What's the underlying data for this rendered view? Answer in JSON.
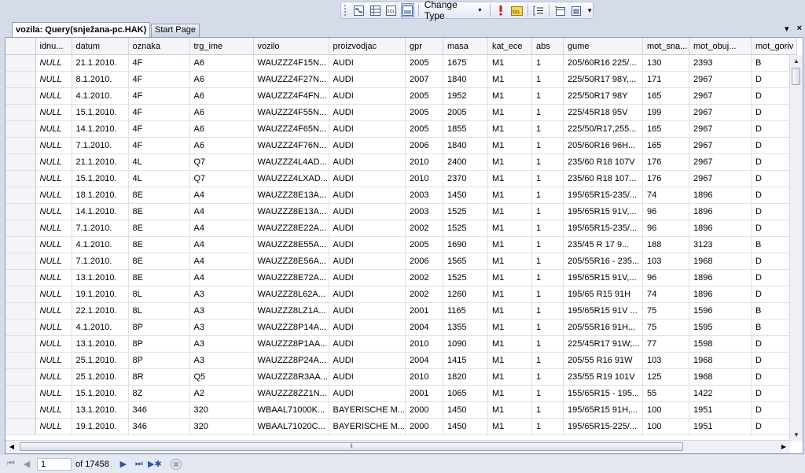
{
  "toolbar": {
    "change_type_label": "Change Type",
    "buttons": [
      "show-diagram-pane-icon",
      "show-grid-pane-icon",
      "show-sql-pane-icon",
      "show-results-pane-icon",
      "execute-sql-icon",
      "verify-sql-icon",
      "group-by-icon",
      "add-table-icon",
      "add-derived-table-icon"
    ]
  },
  "tabs": {
    "active_label": "vozila: Query(snježana-pc.HAK)",
    "second_label": "Start Page",
    "pin_glyph": "▾",
    "close_glyph": "×"
  },
  "grid": {
    "columns": [
      "idnu...",
      "datum",
      "oznaka",
      "trg_ime",
      "vozilo",
      "proizvodjac",
      "gpr",
      "masa",
      "kat_ece",
      "abs",
      "gume",
      "mot_sna...",
      "mot_obuj...",
      "mot_goriv"
    ],
    "rows": [
      [
        "NULL",
        "21.1.2010.",
        "4F",
        "A6",
        "WAUZZZ4F15N...",
        "AUDI",
        "2005",
        "1675",
        "M1",
        "1",
        "205/60R16 225/...",
        "130",
        "2393",
        "B"
      ],
      [
        "NULL",
        "8.1.2010.",
        "4F",
        "A6",
        "WAUZZZ4F27N...",
        "AUDI",
        "2007",
        "1840",
        "M1",
        "1",
        "225/50R17 98Y,...",
        "171",
        "2967",
        "D"
      ],
      [
        "NULL",
        "4.1.2010.",
        "4F",
        "A6",
        "WAUZZZ4F4FN...",
        "AUDI",
        "2005",
        "1952",
        "M1",
        "1",
        "225/50R17 98Y",
        "165",
        "2967",
        "D"
      ],
      [
        "NULL",
        "15.1.2010.",
        "4F",
        "A6",
        "WAUZZZ4F55N...",
        "AUDI",
        "2005",
        "2005",
        "M1",
        "1",
        "225/45R18 95V",
        "199",
        "2967",
        "D"
      ],
      [
        "NULL",
        "14.1.2010.",
        "4F",
        "A6",
        "WAUZZZ4F65N...",
        "AUDI",
        "2005",
        "1855",
        "M1",
        "1",
        "225/50/R17,255...",
        "165",
        "2967",
        "D"
      ],
      [
        "NULL",
        "7.1.2010.",
        "4F",
        "A6",
        "WAUZZZ4F76N...",
        "AUDI",
        "2006",
        "1840",
        "M1",
        "1",
        "205/60R16 96H...",
        "165",
        "2967",
        "D"
      ],
      [
        "NULL",
        "21.1.2010.",
        "4L",
        "Q7",
        "WAUZZZ4L4AD...",
        "AUDI",
        "2010",
        "2400",
        "M1",
        "1",
        "235/60 R18 107V",
        "176",
        "2967",
        "D"
      ],
      [
        "NULL",
        "15.1.2010.",
        "4L",
        "Q7",
        "WAUZZZ4LXAD...",
        "AUDI",
        "2010",
        "2370",
        "M1",
        "1",
        "235/60 R18 107...",
        "176",
        "2967",
        "D"
      ],
      [
        "NULL",
        "18.1.2010.",
        "8E",
        "A4",
        "WAUZZZ8E13A...",
        "AUDI",
        "2003",
        "1450",
        "M1",
        "1",
        "195/65R15-235/...",
        "74",
        "1896",
        "D"
      ],
      [
        "NULL",
        "14.1.2010.",
        "8E",
        "A4",
        "WAUZZZ8E13A...",
        "AUDI",
        "2003",
        "1525",
        "M1",
        "1",
        "195/65R15 91V,...",
        "96",
        "1896",
        "D"
      ],
      [
        "NULL",
        "7.1.2010.",
        "8E",
        "A4",
        "WAUZZZ8E22A...",
        "AUDI",
        "2002",
        "1525",
        "M1",
        "1",
        "195/65R15-235/...",
        "96",
        "1896",
        "D"
      ],
      [
        "NULL",
        "4.1.2010.",
        "8E",
        "A4",
        "WAUZZZ8E55A...",
        "AUDI",
        "2005",
        "1690",
        "M1",
        "1",
        "235/45 R 17 9...",
        "188",
        "3123",
        "B"
      ],
      [
        "NULL",
        "7.1.2010.",
        "8E",
        "A4",
        "WAUZZZ8E56A...",
        "AUDI",
        "2006",
        "1565",
        "M1",
        "1",
        "205/55R16 - 235...",
        "103",
        "1968",
        "D"
      ],
      [
        "NULL",
        "13.1.2010.",
        "8E",
        "A4",
        "WAUZZZ8E72A...",
        "AUDI",
        "2002",
        "1525",
        "M1",
        "1",
        "195/65R15 91V,...",
        "96",
        "1896",
        "D"
      ],
      [
        "NULL",
        "19.1.2010.",
        "8L",
        "A3",
        "WAUZZZ8L62A...",
        "AUDI",
        "2002",
        "1260",
        "M1",
        "1",
        "195/65 R15 91H",
        "74",
        "1896",
        "D"
      ],
      [
        "NULL",
        "22.1.2010.",
        "8L",
        "A3",
        "WAUZZZ8LZ1A...",
        "AUDI",
        "2001",
        "1165",
        "M1",
        "1",
        "195/65R15 91V ...",
        "75",
        "1596",
        "B"
      ],
      [
        "NULL",
        "4.1.2010.",
        "8P",
        "A3",
        "WAUZZZ8P14A...",
        "AUDI",
        "2004",
        "1355",
        "M1",
        "1",
        "205/55R16 91H...",
        "75",
        "1595",
        "B"
      ],
      [
        "NULL",
        "13.1.2010.",
        "8P",
        "A3",
        "WAUZZZ8P1AA...",
        "AUDI",
        "2010",
        "1090",
        "M1",
        "1",
        "225/45R17 91W;...",
        "77",
        "1598",
        "D"
      ],
      [
        "NULL",
        "25.1.2010.",
        "8P",
        "A3",
        "WAUZZZ8P24A...",
        "AUDI",
        "2004",
        "1415",
        "M1",
        "1",
        "205/55 R16 91W",
        "103",
        "1968",
        "D"
      ],
      [
        "NULL",
        "25.1.2010.",
        "8R",
        "Q5",
        "WAUZZZ8R3AA...",
        "AUDI",
        "2010",
        "1820",
        "M1",
        "1",
        "235/55 R19 101V",
        "125",
        "1968",
        "D"
      ],
      [
        "NULL",
        "15.1.2010.",
        "8Z",
        "A2",
        "WAUZZZ8ZZ1N...",
        "AUDI",
        "2001",
        "1065",
        "M1",
        "1",
        "155/65R15 - 195...",
        "55",
        "1422",
        "D"
      ],
      [
        "NULL",
        "13.1.2010.",
        "346",
        "320",
        "WBAAL71000K...",
        "BAYERISCHE M...",
        "2000",
        "1450",
        "M1",
        "1",
        "195/65R15 91H,...",
        "100",
        "1951",
        "D"
      ],
      [
        "NULL",
        "19.1.2010.",
        "346",
        "320",
        "WBAAL71020C...",
        "BAYERISCHE M...",
        "2000",
        "1450",
        "M1",
        "1",
        "195/65R15-225/...",
        "100",
        "1951",
        "D"
      ]
    ]
  },
  "navigator": {
    "current_page": "1",
    "of_label": "of 17458"
  }
}
